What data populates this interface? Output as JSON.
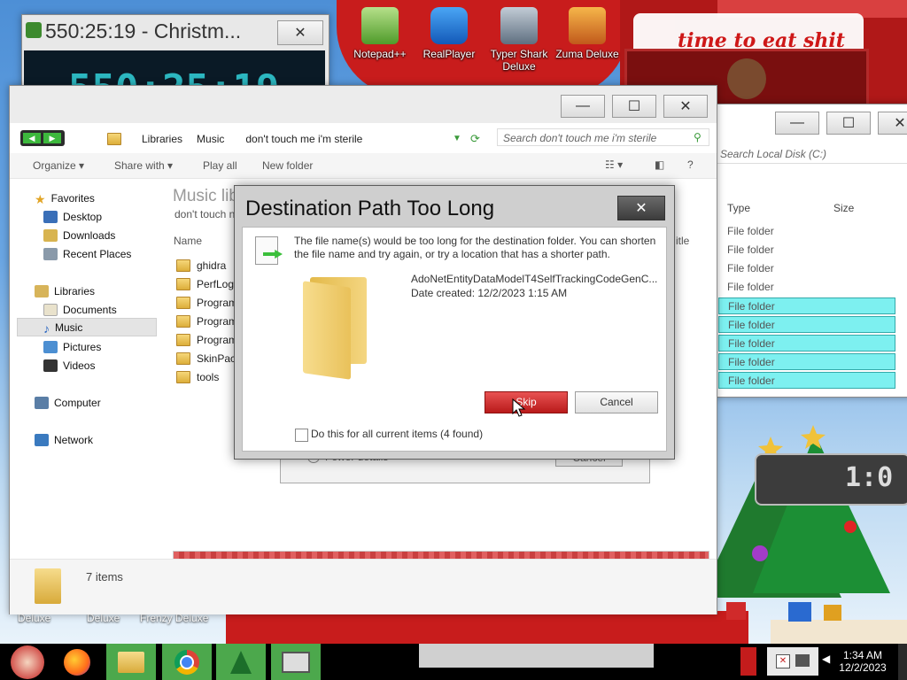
{
  "desktop": {
    "icons": [
      {
        "label": "Notepad++",
        "color": "#6bbf3a"
      },
      {
        "label": "RealPlayer",
        "color": "#1f74d4"
      },
      {
        "label": "Typer Shark Deluxe",
        "color": "#6e7f8f"
      },
      {
        "label": "Zuma Deluxe",
        "color": "#e0791e"
      }
    ],
    "bottom_labels": [
      "Deluxe",
      "Deluxe",
      "Frenzy Deluxe"
    ],
    "banner_text": "time to eat shit",
    "clock_widget": "1:0"
  },
  "timer_window": {
    "title": "550:25:19 - Christm...",
    "display": "550:25:19"
  },
  "explorer": {
    "breadcrumb": [
      "Libraries",
      "Music",
      "don't touch me i'm sterile"
    ],
    "search_placeholder": "Search don't touch me i'm sterile",
    "toolbar": {
      "organize": "Organize",
      "share_with": "Share with",
      "play_all": "Play all",
      "new_folder": "New folder"
    },
    "nav": {
      "favorites": "Favorites",
      "favorites_items": [
        "Desktop",
        "Downloads",
        "Recent Places"
      ],
      "libraries": "Libraries",
      "libraries_items": [
        "Documents",
        "Music",
        "Pictures",
        "Videos"
      ],
      "computer": "Computer",
      "network": "Network"
    },
    "library_title": "Music lib",
    "library_subtitle": "don't touch n",
    "column_name": "Name",
    "column_title_partial": "itle",
    "files": [
      "ghidra",
      "PerfLogs",
      "Program",
      "Program",
      "Program",
      "SkinPack",
      "tools"
    ],
    "status": "7 items",
    "progress_percent": 100
  },
  "second_explorer": {
    "search_placeholder": "Search Local Disk (C:)",
    "col_type": "Type",
    "col_size": "Size",
    "types": [
      "File folder",
      "File folder",
      "File folder",
      "File folder",
      "File folder",
      "File folder",
      "File folder",
      "File folder",
      "File folder"
    ]
  },
  "copy_dialog": {
    "fewer_details": "Fewer details",
    "cancel": "Cancel"
  },
  "dialog": {
    "title": "Destination Path Too Long",
    "message": "The file name(s) would be too long for the destination folder.  You can shorten the file name and try again, or try a location that has a shorter path.",
    "file_name": "AdoNetEntityDataModelT4SelfTrackingCodeGenC...",
    "date_created": "Date created: 12/2/2023 1:15 AM",
    "skip_label": "Skip",
    "cancel_label": "Cancel",
    "checkbox_label": "Do this for all current items (4 found)",
    "checkbox_checked": false
  },
  "taskbar": {
    "time": "1:34 AM",
    "date": "12/2/2023"
  }
}
